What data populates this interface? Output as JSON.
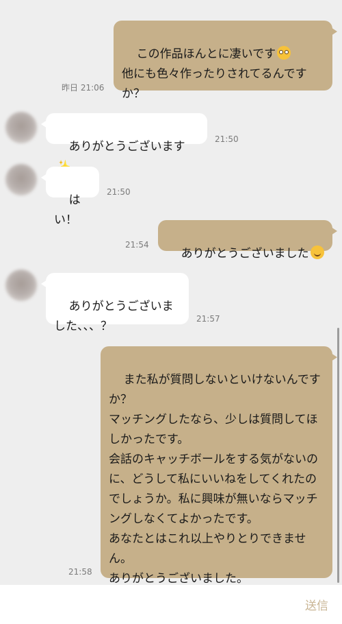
{
  "messages": [
    {
      "text": "この作品ほんとに凄いです",
      "text2": "他にも色々作ったりされてるんですか？",
      "time": "昨日 21:06",
      "emoji": "flushed-face-icon"
    },
    {
      "text": "ありがとうございます",
      "time": "21:50",
      "emoji": "sparkles-icon"
    },
    {
      "text": "はい！",
      "time": "21:50"
    },
    {
      "text": "ありがとうございました",
      "time": "21:54",
      "emoji": "smiling-face-icon"
    },
    {
      "text": "ありがとうございました、、、？",
      "time": "21:57"
    },
    {
      "text": "また私が質問しないといけないんですか？\nマッチングしたなら、少しは質問してほしかったです。\n会話のキャッチボールをする気がないのに、どうして私にいいねをしてくれたのでしょうか。私に興味が無いならマッチングしなくてよかったです。\nあなたとはこれ以上やりとりできません。\nありがとうございました。",
      "time": "21:58"
    }
  ],
  "input": {
    "placeholder": ""
  },
  "send_label": "送信",
  "colors": {
    "sent_bubble": "#c6b08a",
    "received_bubble": "#ffffff",
    "background": "#eeeeee",
    "send_label": "#c9b594"
  }
}
